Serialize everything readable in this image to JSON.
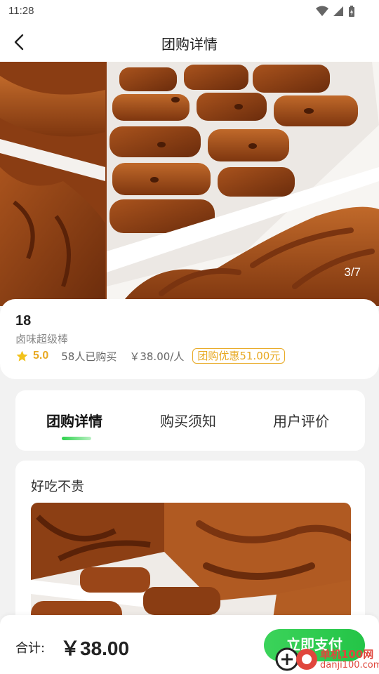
{
  "status_bar": {
    "time": "11:28"
  },
  "nav": {
    "title": "团购详情",
    "back_icon": "chevron-left-icon"
  },
  "gallery": {
    "counter": "3/7"
  },
  "deal": {
    "title": "18",
    "subtitle": "卤味超级棒",
    "rating": "5.0",
    "bought": "58人已购买",
    "unit_price": "￥38.00/人",
    "discount_badge": "团购优惠51.00元",
    "colors": {
      "accent_gold": "#e8a923"
    }
  },
  "tabs": {
    "items": [
      {
        "label": "团购详情",
        "active": true
      },
      {
        "label": "购买须知",
        "active": false
      },
      {
        "label": "用户评价",
        "active": false
      }
    ],
    "colors": {
      "indicator": "#2fd24d"
    }
  },
  "detail": {
    "heading": "好吃不贵"
  },
  "bottom_bar": {
    "total_label": "合计:",
    "total_value": "￥38.00",
    "pay_button": "立即支付",
    "colors": {
      "pay": "#24c447"
    }
  },
  "watermark": {
    "text": "单机100网",
    "url": "danji100.com"
  }
}
